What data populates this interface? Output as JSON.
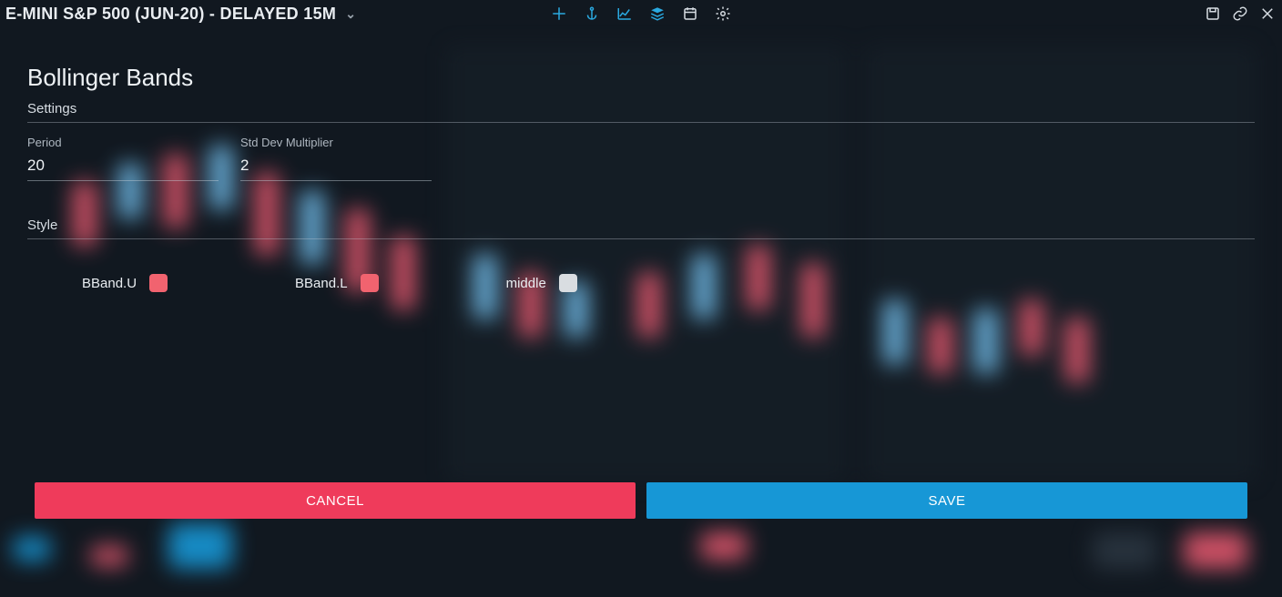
{
  "header": {
    "title": "E-MINI S&P 500 (JUN-20) - DELAYED 15M"
  },
  "modal": {
    "title": "Bollinger Bands",
    "settings_label": "Settings",
    "fields": {
      "period": {
        "label": "Period",
        "value": "20"
      },
      "stddev": {
        "label": "Std Dev Multiplier",
        "value": "2"
      }
    },
    "style_label": "Style",
    "styles": {
      "upper": {
        "label": "BBand.U",
        "color": "#f1636f"
      },
      "lower": {
        "label": "BBand.L",
        "color": "#f1636f"
      },
      "middle": {
        "label": "middle",
        "color": "#d9dde1"
      }
    },
    "buttons": {
      "cancel": "CANCEL",
      "save": "SAVE"
    }
  },
  "colors": {
    "accent_blue": "#1797d6",
    "accent_red": "#ef3b5b",
    "candle_up": "#6fb9e6",
    "candle_down": "#e0566c"
  }
}
